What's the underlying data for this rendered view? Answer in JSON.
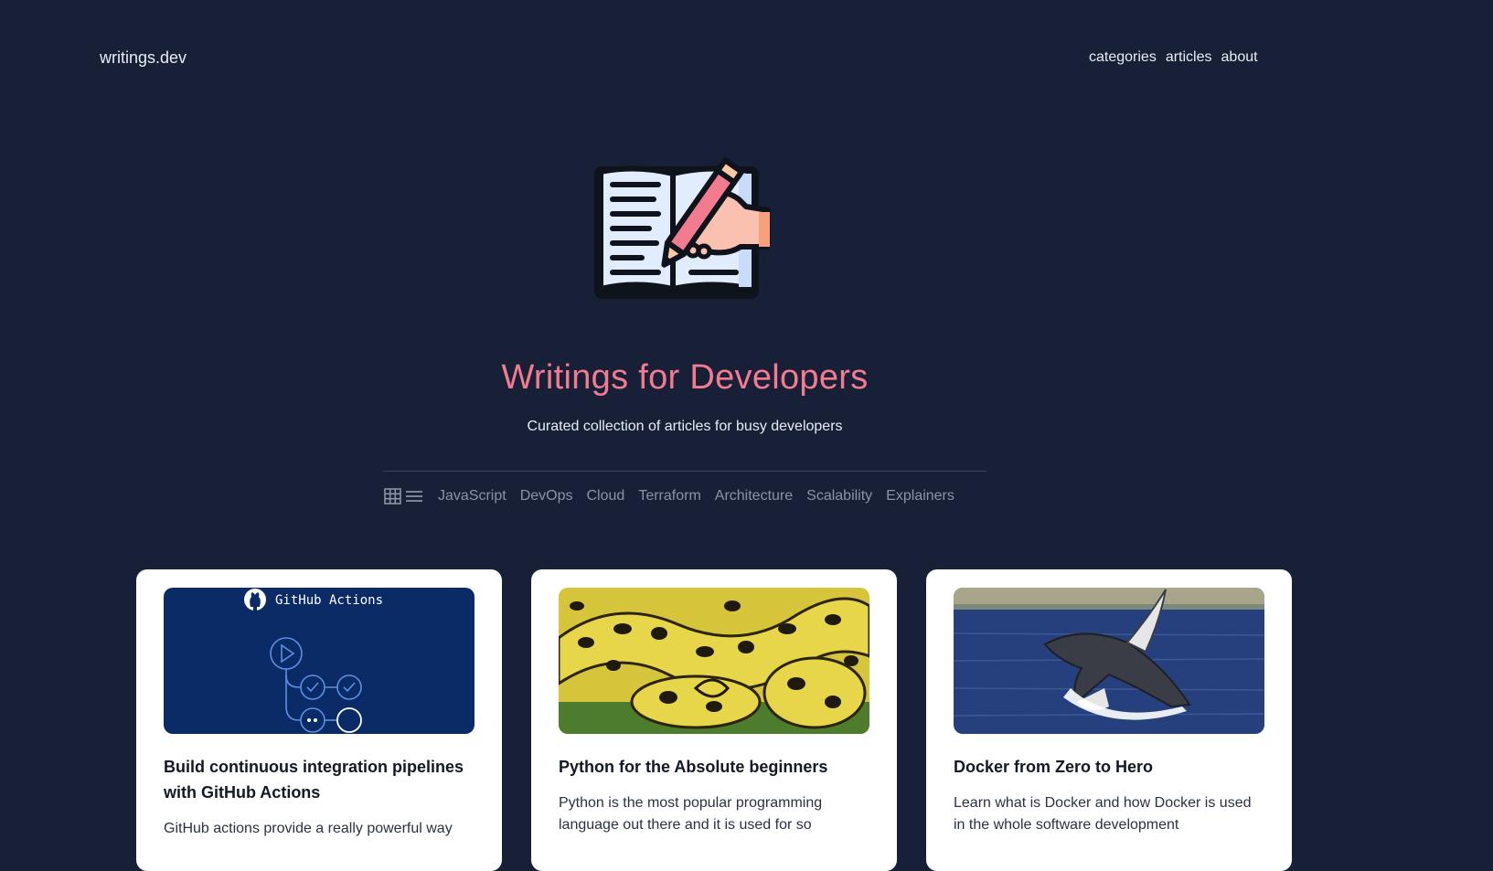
{
  "header": {
    "brand": "writings.dev",
    "nav": [
      "categories",
      "articles",
      "about"
    ]
  },
  "hero": {
    "illustration_icon": "book-and-pencil-icon",
    "title": "Writings for Developers",
    "subtitle": "Curated collection of articles for busy developers"
  },
  "filters": {
    "view_icons": [
      "grid-view-icon",
      "list-view-icon"
    ],
    "categories": [
      "JavaScript",
      "DevOps",
      "Cloud",
      "Terraform",
      "Architecture",
      "Scalability",
      "Explainers"
    ]
  },
  "articles": [
    {
      "image_text": "GitHub Actions",
      "title": "Build continuous integration pipelines with GitHub Actions",
      "excerpt": "GitHub actions provide a really powerful way"
    },
    {
      "title": "Python for the Absolute beginners",
      "excerpt": "Python is the most popular programming language out there and it is used for so"
    },
    {
      "title": "Docker from Zero to Hero",
      "excerpt": "Learn what is Docker and how Docker is used in the whole software development"
    }
  ],
  "colors": {
    "background": "#172037",
    "title_accent": "#f27b8f",
    "muted_link": "#8b93a4",
    "card": "#ffffff"
  }
}
